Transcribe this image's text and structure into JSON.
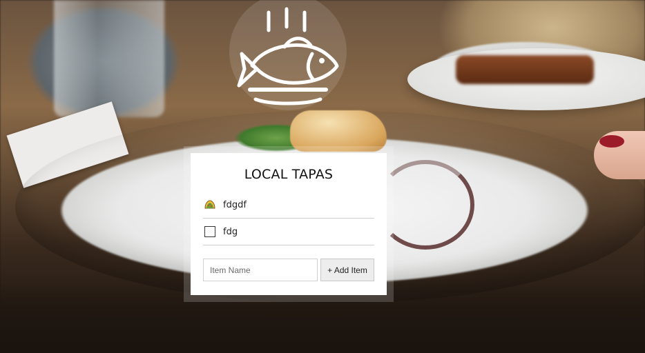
{
  "app": {
    "title": "LOCAL TAPAS"
  },
  "logo": {
    "icon": "fish-on-plate-logo-icon"
  },
  "list": {
    "items": [
      {
        "label": "fdgdf",
        "state": "completed",
        "icon": "taco-icon"
      },
      {
        "label": "fdg",
        "state": "unchecked",
        "icon": "checkbox-icon"
      }
    ]
  },
  "form": {
    "input_placeholder": "Item Name",
    "input_value": "",
    "add_button_label": "+ Add Item"
  },
  "colors": {
    "card_background": "#ffffff",
    "button_background": "#ededed",
    "divider": "#cfcfcf",
    "title_text": "#111111"
  }
}
